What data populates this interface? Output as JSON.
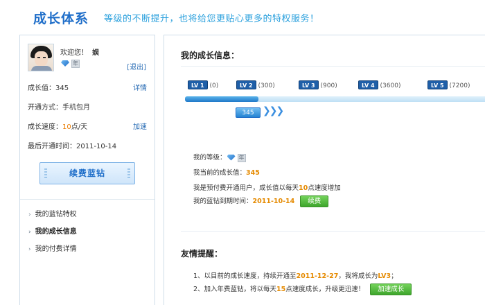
{
  "header": {
    "title": "成长体系",
    "subtitle": "等级的不断提升，也将给您更贴心更多的特权服务！"
  },
  "profile": {
    "welcome": "欢迎您！",
    "username": "娱",
    "logout": "[退出]",
    "year_badge": "年",
    "growth_label": "成长值：345",
    "growth_action": "详情",
    "method_label": "开通方式：手机包月",
    "speed_prefix": "成长速度：",
    "speed_value": "10",
    "speed_suffix": "点/天",
    "speed_action": "加速",
    "last_open": "最后开通时间：2011-10-14",
    "renew_button": "续费蓝钻"
  },
  "menu": {
    "items": [
      {
        "label": "我的蓝钻特权"
      },
      {
        "label": "我的成长信息"
      },
      {
        "label": "我的付费详情"
      }
    ]
  },
  "growth": {
    "title": "我的成长信息：",
    "levels": [
      {
        "badge": "LV 1",
        "points": "(0)"
      },
      {
        "badge": "LV 2",
        "points": "(300)"
      },
      {
        "badge": "LV 3",
        "points": "(900)"
      },
      {
        "badge": "LV 4",
        "points": "(3600)"
      },
      {
        "badge": "LV 5",
        "points": "(7200)"
      }
    ],
    "progress_fraction": 0.24,
    "current_value": "345",
    "arrows": "❯❯❯",
    "my_level_label": "我的等级：",
    "current_growth_prefix": "我当前的成长值：",
    "current_growth_value": "345",
    "prepaid_prefix": "我是预付费开通用户，成长值以每天",
    "prepaid_value": "10",
    "prepaid_suffix": "点速度增加",
    "expire_prefix": "我的蓝钻到期时间：",
    "expire_value": "2011-10-14",
    "renew_small": "续费"
  },
  "tips": {
    "title": "友情提醒：",
    "line1_prefix": "1、以目前的成长速度，持续开通至",
    "line1_date": "2011-12-27",
    "line1_mid": "，我将成长为",
    "line1_level": "LV3",
    "line1_suffix": "；",
    "line2_prefix": "2、加入年费蓝钻，将以每天",
    "line2_value": "15",
    "line2_suffix": "点速度成长，升级更迅速！",
    "speedup_button": "加速成长"
  },
  "colors": {
    "brand_blue": "#1f6ec9",
    "accent_orange": "#e58a00",
    "button_green": "#3ea52c"
  }
}
